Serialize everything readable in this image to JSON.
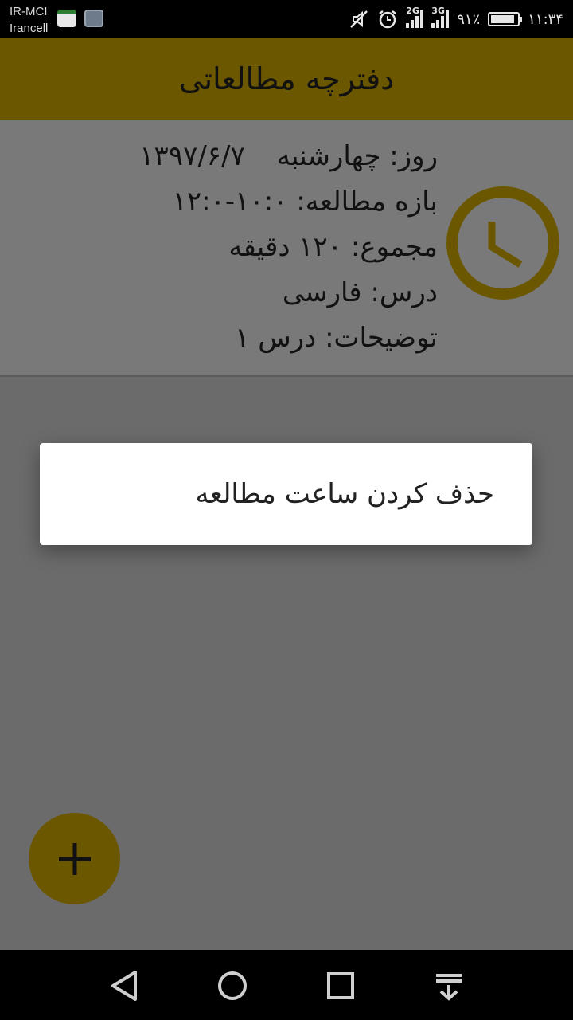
{
  "status_bar": {
    "carrier_1": "IR-MCI",
    "carrier_2": "Irancell",
    "network_1": "2G",
    "network_2": "3G",
    "battery_percent": "۹۱٪",
    "battery_level": 0.91,
    "time": "۱۱:۳۴",
    "icons": [
      "calendar-notification-icon",
      "image-notification-icon",
      "muted-icon",
      "alarm-icon",
      "signal-icon",
      "battery-icon"
    ]
  },
  "app_bar": {
    "title": "دفترچه مطالعاتی"
  },
  "entry": {
    "day_label": "روز: چهارشنبه",
    "date": "۱۳۹۷/۶/۷",
    "range": "بازه مطالعه: ۱۰:۰-۱۲:۰",
    "total": "مجموع: ۱۲۰ دقیقه",
    "lesson": "درس: فارسی",
    "notes": "توضیحات: درس ۱",
    "icon": "clock-icon"
  },
  "dialog": {
    "item_label": "حذف کردن ساعت مطالعه"
  },
  "fab": {
    "icon": "plus-icon"
  },
  "nav_bar": {
    "icons": [
      "back-icon",
      "home-icon",
      "recents-icon",
      "notification-pull-icon"
    ]
  },
  "colors": {
    "accent": "#6b5700",
    "scrim_bg": "#6b6b6b",
    "clock": "#6b5700"
  }
}
